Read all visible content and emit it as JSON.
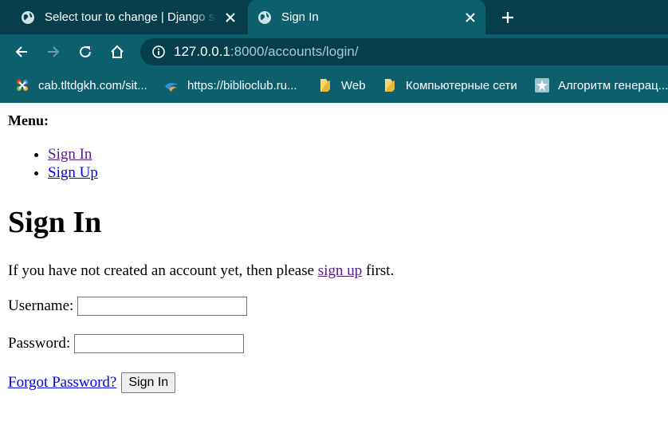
{
  "browser": {
    "tabs": [
      {
        "title": "Select tour to change | Django site admin",
        "active": false,
        "favicon": "globe-icon"
      },
      {
        "title": "Sign In",
        "active": true,
        "favicon": "globe-icon"
      }
    ],
    "address": {
      "host": "127.0.0.1",
      "rest": ":8000/accounts/login/"
    },
    "bookmarks": [
      {
        "label": "cab.tltdgkh.com/sit...",
        "icon": "joomla-icon"
      },
      {
        "label": "https://biblioclub.ru...",
        "icon": "biblioclub-icon"
      },
      {
        "label": "Web",
        "icon": "folder-icon"
      },
      {
        "label": "Компьютерные сети",
        "icon": "folder-icon"
      },
      {
        "label": "Алгоритм генерац...",
        "icon": "star-icon"
      }
    ],
    "colors": {
      "frame": "#063f4b",
      "toolbar": "#0e5f6e"
    }
  },
  "page": {
    "menu_label": "Menu:",
    "menu_items": [
      "Sign In",
      "Sign Up"
    ],
    "heading": "Sign In",
    "intro_before": "If you have not created an account yet, then please",
    "intro_link": "sign up",
    "intro_after": "first.",
    "username_label": "Username:",
    "username_value": "",
    "password_label": "Password:",
    "password_value": "",
    "forgot_link": "Forgot Password?",
    "submit_label": "Sign In"
  }
}
